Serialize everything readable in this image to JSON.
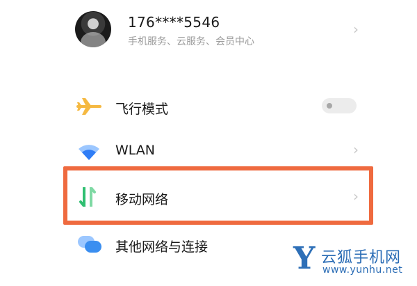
{
  "account": {
    "name": "176****5546",
    "subtitle": "手机服务、云服务、会员中心",
    "chevron": "›"
  },
  "settings": {
    "items": [
      {
        "label": "飞行模式",
        "icon": "airplane-icon",
        "control": "toggle",
        "toggle_on": false
      },
      {
        "label": "WLAN",
        "icon": "wifi-icon",
        "control": "chevron",
        "chevron": "›"
      },
      {
        "label": "移动网络",
        "icon": "mobile-data-icon",
        "control": "chevron",
        "chevron": "›",
        "highlighted": true
      },
      {
        "label": "其他网络与连接",
        "icon": "connections-icon",
        "control": "none"
      }
    ]
  },
  "colors": {
    "highlight": "#ef6a3f",
    "airplane": "#f5b942",
    "wifi": "#2f7df6",
    "mobile_data": "#2fbf71",
    "connections": "#3a8ef0",
    "watermark": "#2a6cb5"
  },
  "watermark": {
    "logo_letter": "Y",
    "brand": "云狐手机网",
    "url": "www.yunhu.net"
  }
}
